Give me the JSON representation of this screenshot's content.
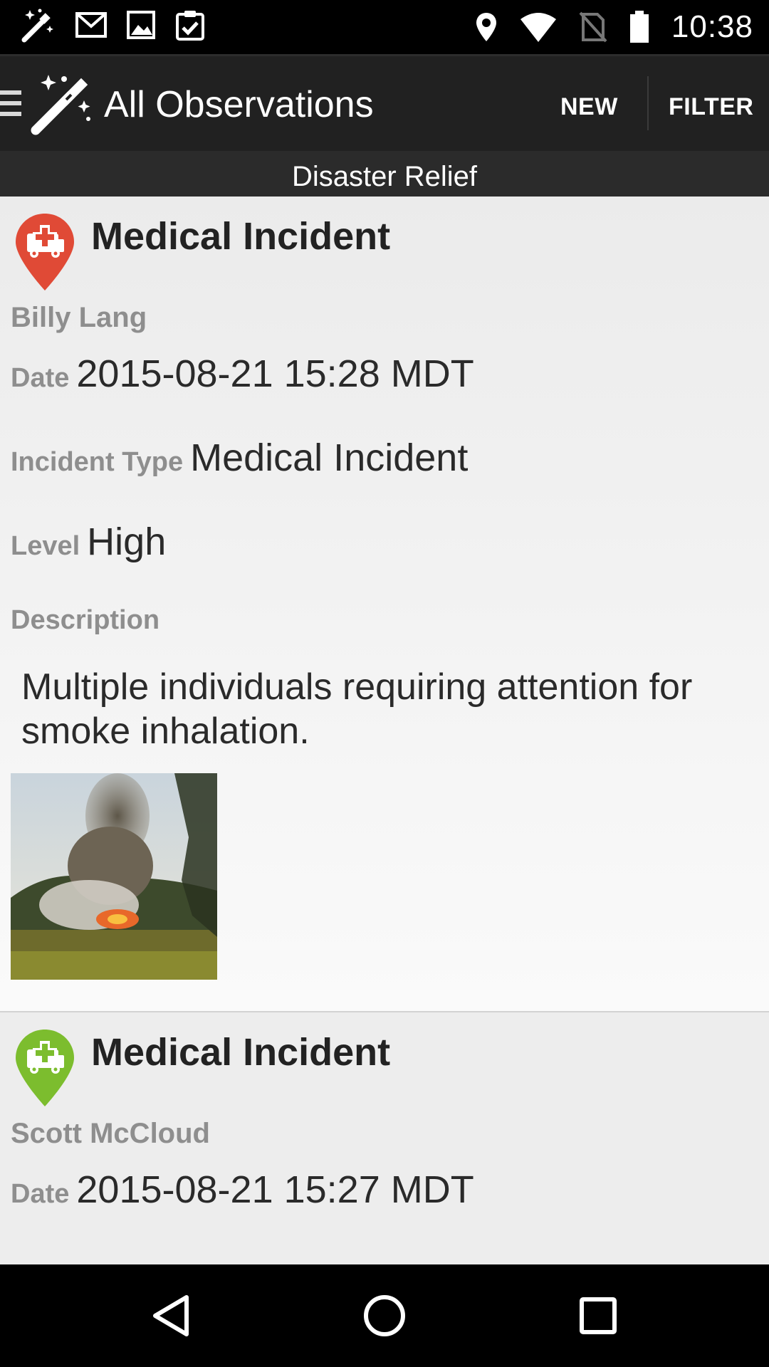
{
  "status_bar": {
    "time": "10:38",
    "left_icons": [
      "magic-wand-icon",
      "gmail-icon",
      "image-icon",
      "clipboard-check-icon"
    ],
    "right_icons": [
      "location-icon",
      "wifi-icon",
      "no-sim-icon",
      "battery-icon"
    ]
  },
  "app_bar": {
    "title": "All Observations",
    "new_label": "NEW",
    "filter_label": "FILTER"
  },
  "event_name": "Disaster Relief",
  "observations": [
    {
      "title": "Medical Incident",
      "reporter": "Billy Lang",
      "marker_color": "#e04a36",
      "date_label": "Date",
      "date_value": "2015-08-21 15:28 MDT",
      "type_label": "Incident Type",
      "type_value": "Medical Incident",
      "level_label": "Level",
      "level_value": "High",
      "description_label": "Description",
      "description": "Multiple individuals requiring attention for smoke inhalation.",
      "attachment": "wildfire-smoke-photo"
    },
    {
      "title": "Medical Incident",
      "reporter": "Scott McCloud",
      "marker_color": "#7cbd2e",
      "date_label": "Date",
      "date_value": "2015-08-21 15:27 MDT"
    }
  ],
  "nav_bar": {
    "icons": [
      "back-icon",
      "home-icon",
      "recents-icon"
    ]
  }
}
